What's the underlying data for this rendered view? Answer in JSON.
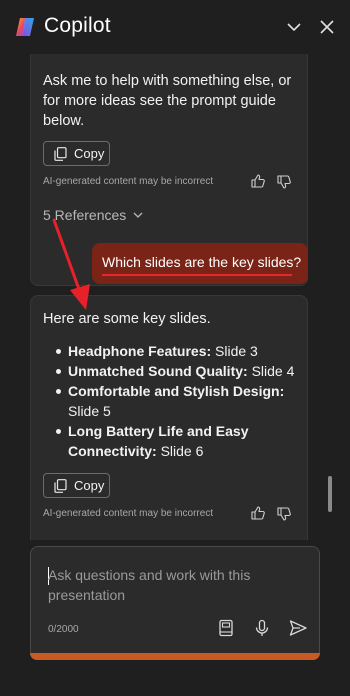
{
  "app": {
    "title": "Copilot"
  },
  "messages": {
    "first": {
      "text_lines": [
        "Ask me to help with something else, or",
        "for more ideas see the prompt guide",
        "below."
      ],
      "copy_label": "Copy",
      "disclaimer": "AI-generated content may be incorrect",
      "references_label": "5 References"
    },
    "user": {
      "text": "Which slides are the key slides?"
    },
    "second": {
      "intro": "Here are some key slides.",
      "items": [
        {
          "title": "Headphone Features:",
          "detail": " Slide 3"
        },
        {
          "title": "Unmatched Sound Quality:",
          "detail": " Slide 4"
        },
        {
          "title": "Comfortable and Stylish Design:",
          "detail": " Slide 5"
        },
        {
          "title": "Long Battery Life and Easy Connectivity:",
          "detail": " Slide 6"
        }
      ],
      "copy_label": "Copy",
      "disclaimer": "AI-generated content may be incorrect"
    }
  },
  "composer": {
    "placeholder": "Ask questions and work with this presentation",
    "char_count": "0/2000"
  },
  "colors": {
    "background": "#1f1f1f",
    "card": "#2b2b2b",
    "user_bubble": "#7a2418",
    "accent_bar": "#c95a24"
  },
  "icons": [
    "copilot-logo",
    "chevron-down-icon",
    "close-icon",
    "copy-icon",
    "thumbs-up-icon",
    "thumbs-down-icon",
    "notebook-icon",
    "microphone-icon",
    "send-icon"
  ]
}
